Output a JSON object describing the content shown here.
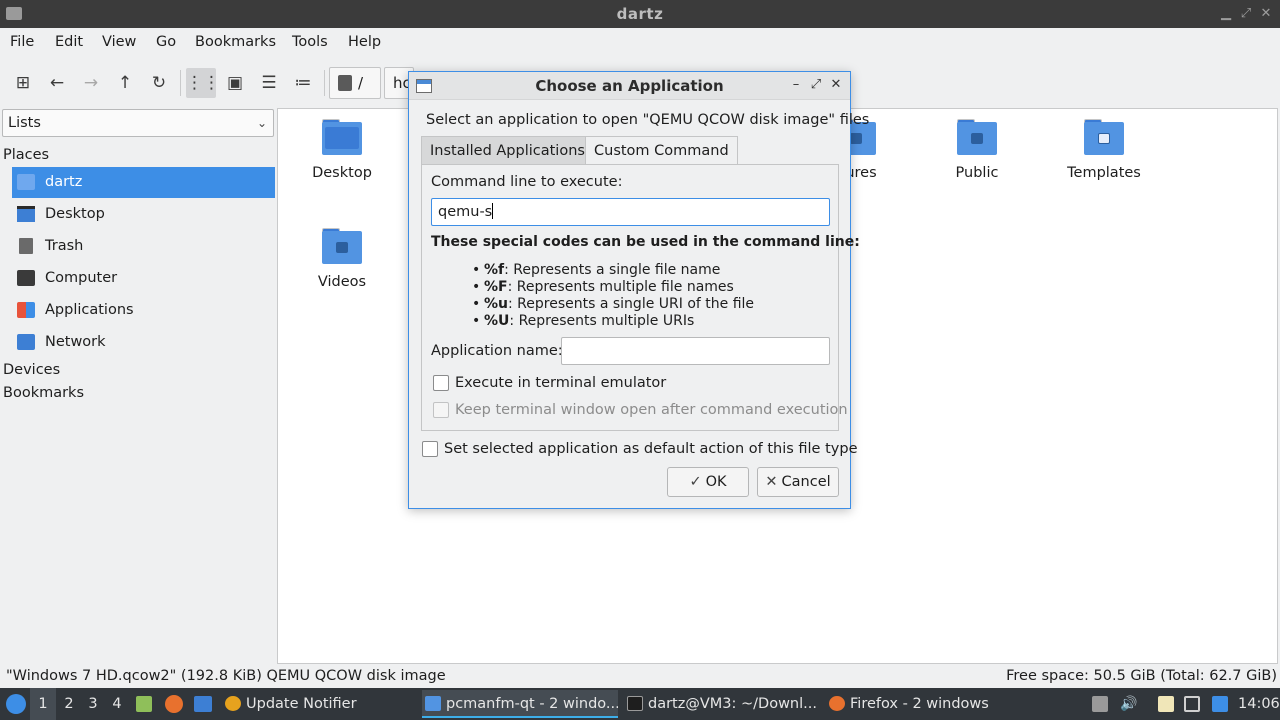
{
  "window": {
    "title": "dartz"
  },
  "menu": [
    "File",
    "Edit",
    "View",
    "Go",
    "Bookmarks",
    "Tools",
    "Help"
  ],
  "toolbar": {
    "path_root": "/",
    "path_segment": "hc"
  },
  "sidebar": {
    "combo_value": "Lists",
    "places_heading": "Places",
    "items": [
      {
        "label": "dartz",
        "icon": "home-folder-icon",
        "selected": true
      },
      {
        "label": "Desktop",
        "icon": "desktop-icon"
      },
      {
        "label": "Trash",
        "icon": "trash-icon"
      },
      {
        "label": "Computer",
        "icon": "computer-icon"
      },
      {
        "label": "Applications",
        "icon": "applications-icon"
      },
      {
        "label": "Network",
        "icon": "network-icon"
      }
    ],
    "devices_heading": "Devices",
    "bookmarks_heading": "Bookmarks"
  },
  "files": [
    {
      "label": "Desktop",
      "icon": "folder-desktop-icon"
    },
    {
      "label": "ures",
      "icon": "folder-pictures-icon"
    },
    {
      "label": "Public",
      "icon": "folder-public-icon"
    },
    {
      "label": "Templates",
      "icon": "folder-templates-icon"
    },
    {
      "label": "Videos",
      "icon": "folder-videos-icon"
    }
  ],
  "statusbar": {
    "left": "\"Windows 7 HD.qcow2\" (192.8 KiB) QEMU QCOW disk image",
    "right": "Free space: 50.5 GiB (Total: 62.7 GiB)"
  },
  "dialog": {
    "title": "Choose an Application",
    "description": "Select an application to open \"QEMU QCOW disk image\" files",
    "tabs": {
      "installed": "Installed Applications",
      "custom": "Custom Command"
    },
    "command_label": "Command line to execute:",
    "command_value": "qemu-s",
    "codes_heading": "These special codes can be used in the command line:",
    "codes": [
      {
        "code": "%f",
        "desc": ": Represents a single file name"
      },
      {
        "code": "%F",
        "desc": ": Represents multiple file names"
      },
      {
        "code": "%u",
        "desc": ": Represents a single URI of the file"
      },
      {
        "code": "%U",
        "desc": ": Represents multiple URIs"
      }
    ],
    "app_name_label": "Application name:",
    "app_name_value": "",
    "exec_terminal_label": "Execute in terminal emulator",
    "keep_open_label": "Keep terminal window open after command execution",
    "set_default_label": "Set selected application as default action of this file type",
    "ok_label": "OK",
    "cancel_label": "Cancel"
  },
  "taskbar": {
    "desktops": [
      "1",
      "2",
      "3",
      "4"
    ],
    "tasks": [
      {
        "label": "Update Notifier",
        "icon": "update-notifier-icon"
      },
      {
        "label": "pcmanfm-qt - 2 windo...",
        "icon": "file-manager-icon",
        "active": true
      },
      {
        "label": "dartz@VM3: ~/Downl...",
        "icon": "terminal-icon"
      },
      {
        "label": "Firefox - 2 windows",
        "icon": "firefox-icon"
      }
    ],
    "clock": "14:06"
  },
  "colors": {
    "accent": "#3d8ee6",
    "folder": "#5294e2",
    "taskbar": "#31363b"
  }
}
